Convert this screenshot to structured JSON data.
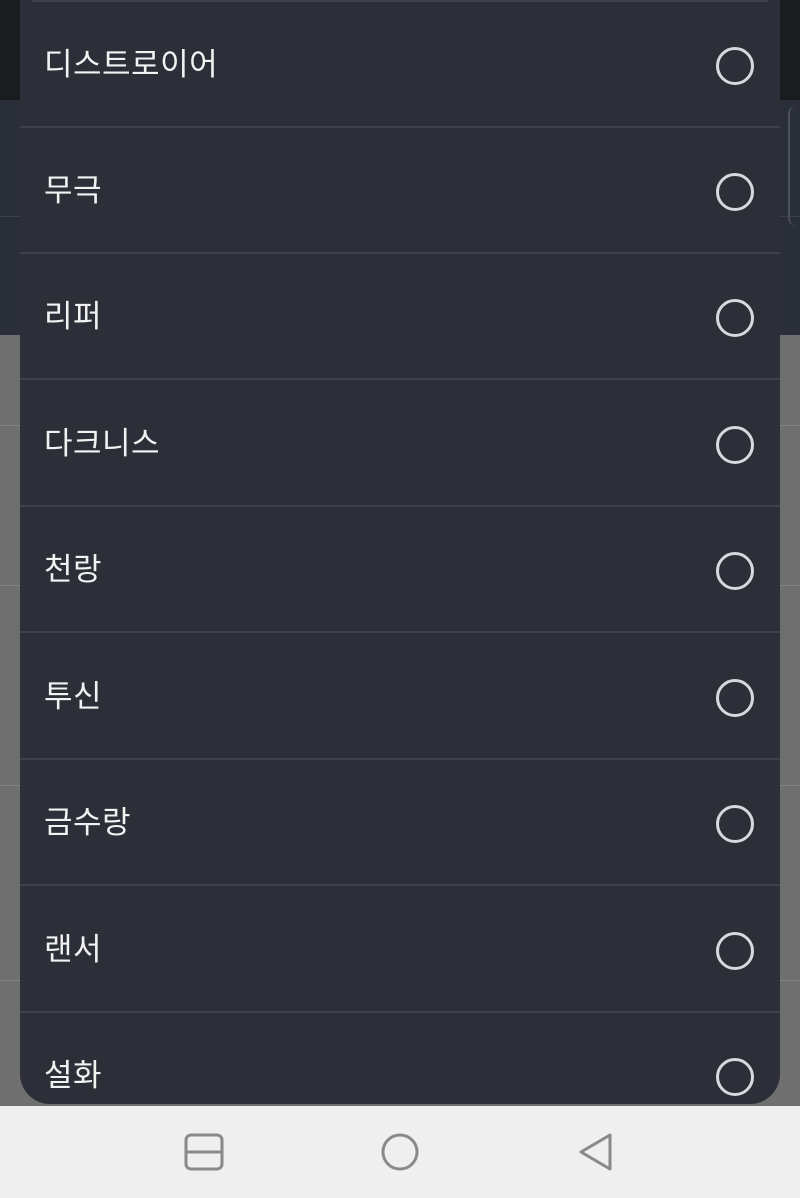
{
  "dialog": {
    "options": [
      {
        "label": "디스트로이어",
        "selected": false
      },
      {
        "label": "무극",
        "selected": false
      },
      {
        "label": "리퍼",
        "selected": false
      },
      {
        "label": "다크니스",
        "selected": false
      },
      {
        "label": "천랑",
        "selected": false
      },
      {
        "label": "투신",
        "selected": false
      },
      {
        "label": "금수랑",
        "selected": false
      },
      {
        "label": "랜서",
        "selected": false
      },
      {
        "label": "설화",
        "selected": false
      }
    ]
  },
  "navbar": {
    "buttons": [
      {
        "icon": "recent-apps-icon"
      },
      {
        "icon": "home-icon"
      },
      {
        "icon": "back-icon"
      }
    ]
  },
  "colors": {
    "dialog_bg": "#2c2f38",
    "divider": "#3e424f",
    "text": "#f2f2f2",
    "radio_ring": "#d7d9de",
    "navbar_bg": "#efefef"
  }
}
